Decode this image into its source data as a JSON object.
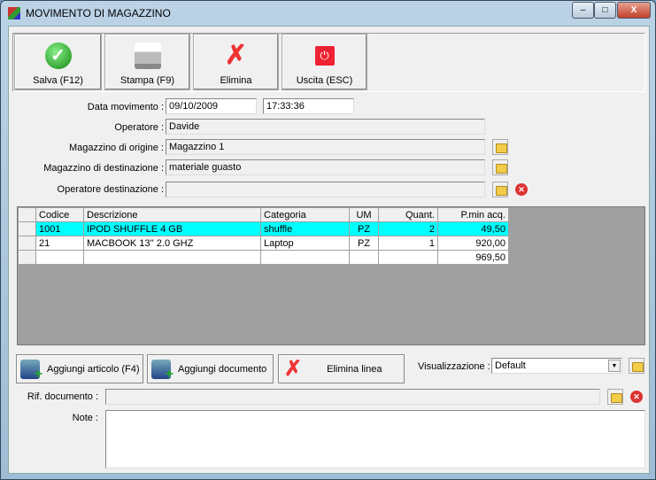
{
  "window": {
    "title": "MOVIMENTO DI MAGAZZINO",
    "minimize": "–",
    "maximize": "□",
    "close": "X"
  },
  "toolbar": {
    "save": "Salva (F12)",
    "print": "Stampa (F9)",
    "delete": "Elimina",
    "exit": "Uscita (ESC)"
  },
  "form": {
    "date_label": "Data movimento :",
    "date": "09/10/2009",
    "time": "17:33:36",
    "operator_label": "Operatore :",
    "operator": "Davide",
    "origin_label": "Magazzino di origine :",
    "origin": "Magazzino 1",
    "dest_label": "Magazzino di destinazione :",
    "dest": "materiale guasto",
    "dest_operator_label": "Operatore destinazione :",
    "dest_operator": ""
  },
  "grid": {
    "headers": [
      "Codice",
      "Descrizione",
      "Categoria",
      "UM",
      "Quant.",
      "P.min acq."
    ],
    "rows": [
      [
        "1001",
        "IPOD SHUFFLE 4 GB",
        "shuffle",
        "PZ",
        "2",
        "49,50"
      ],
      [
        "21",
        "MACBOOK 13'' 2.0 GHZ",
        "Laptop",
        "PZ",
        "1",
        "920,00"
      ]
    ],
    "total": "969,50"
  },
  "actions": {
    "add_item": "Aggiungi articolo (F4)",
    "add_doc": "Aggiungi documento",
    "delete_line": "Elimina linea",
    "view_label": "Visualizzazione :",
    "view_value": "Default"
  },
  "doc": {
    "ref_label": "Rif. documento :",
    "ref": "",
    "notes_label": "Note :",
    "notes": ""
  }
}
